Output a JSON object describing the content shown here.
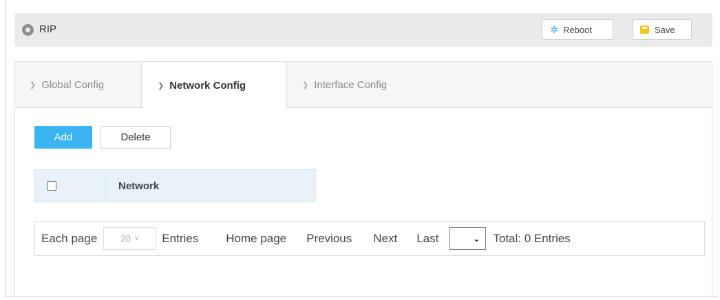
{
  "header": {
    "title": "RIP",
    "reboot_label": "Reboot",
    "save_label": "Save"
  },
  "tabs": [
    {
      "label": "Global Config",
      "active": false
    },
    {
      "label": "Network Config",
      "active": true
    },
    {
      "label": "Interface Config",
      "active": false
    }
  ],
  "actions": {
    "add_label": "Add",
    "delete_label": "Delete"
  },
  "table": {
    "columns": [
      "Network"
    ],
    "rows": []
  },
  "pager": {
    "each_page_label": "Each page",
    "page_size": "20",
    "entries_label": "Entries",
    "home_label": "Home page",
    "previous_label": "Previous",
    "next_label": "Next",
    "last_label": "Last",
    "current_page": "",
    "total_label": "Total: 0 Entries"
  },
  "colors": {
    "accent": "#3bb4f2",
    "save_icon": "#f0c419",
    "header_bg": "#ebebeb",
    "table_header_bg": "#e8f2f8"
  }
}
